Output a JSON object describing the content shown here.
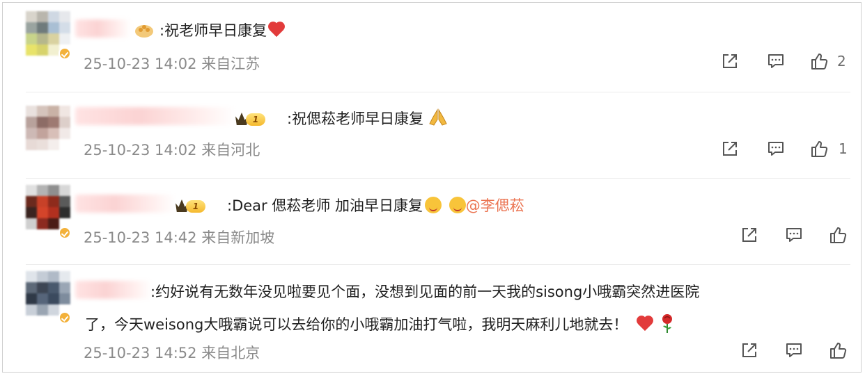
{
  "comments": [
    {
      "text": ":祝老师早日康复",
      "date": "25-10-23 14:02",
      "location": "来自江苏",
      "likes": "2",
      "emoji": [
        "heart-emoji"
      ]
    },
    {
      "text": ":祝偲菘老师早日康复",
      "date": "25-10-23 14:02",
      "location": "来自河北",
      "likes": "1",
      "level": "1",
      "emoji": [
        "pray-emoji"
      ]
    },
    {
      "text": ":Dear 偲菘老师 加油早日康复",
      "mention": "@李偲菘",
      "date": "25-10-23 14:42",
      "location": "来自新加坡",
      "likes": "",
      "level": "1",
      "emoji": [
        "kiss-emoji",
        "kiss-emoji"
      ]
    },
    {
      "text_line1": ":约好说有无数年没见啦要见个面，没想到见面的前一天我的sisong小哦霸突然进医院",
      "text_line2": "了，今天weisong大哦霸说可以去给你的小哦霸加油打气啦，我明天麻利儿地就去！",
      "date": "25-10-23 14:52",
      "location": "来自北京",
      "likes": "",
      "emoji": [
        "heart-emoji",
        "rose-emoji"
      ]
    }
  ],
  "colors": {
    "meta": "#8a8a8a",
    "mention": "#eb7350",
    "icon": "#555555"
  }
}
